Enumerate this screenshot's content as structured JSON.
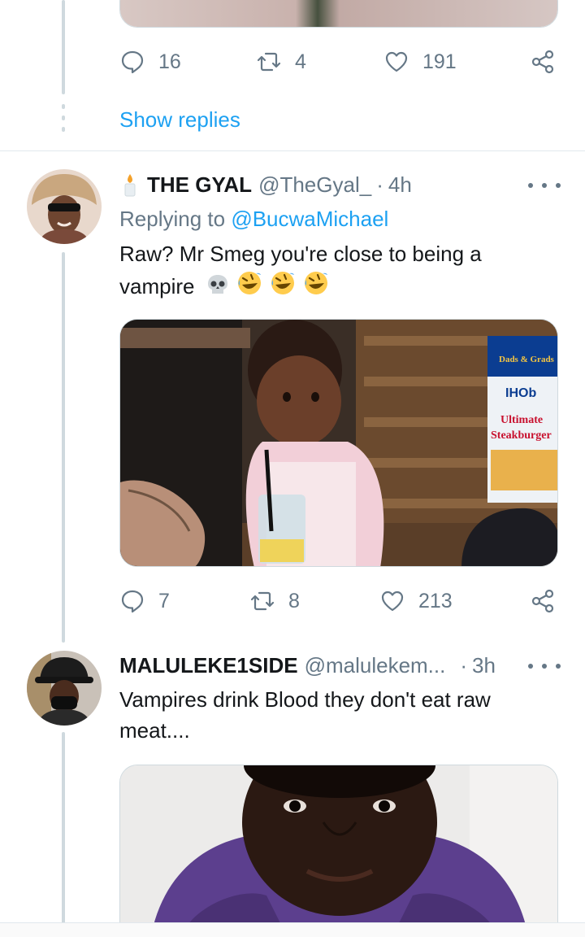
{
  "tweets": [
    {
      "replies": "16",
      "retweets": "4",
      "likes": "191",
      "show_replies": "Show replies"
    },
    {
      "name": "THE GYAL",
      "name_emoji": "candle",
      "handle": "@TheGyal_",
      "separator": "·",
      "time": "4h",
      "replying_prefix": "Replying to",
      "replying_to": "@BucwaMichael",
      "text_line1": "Raw? Mr Smeg you're close to being a",
      "text_line2": "vampire",
      "emojis": [
        "skull",
        "rolling-on-floor-laughing",
        "rolling-on-floor-laughing",
        "rolling-on-floor-laughing"
      ],
      "media_labels": {
        "brand": "IHOb",
        "promo_top": "Dads & Grads",
        "promo_title_1": "Ultimate",
        "promo_title_2": "Steakburger"
      },
      "replies": "7",
      "retweets": "8",
      "likes": "213"
    },
    {
      "name": "MALULEKE1SIDE",
      "handle": "@malulekem...",
      "separator": "·",
      "time": "3h",
      "text_line1": "Vampires drink Blood they don't eat raw",
      "text_line2": "meat...."
    }
  ],
  "colors": {
    "link": "#1da1f2",
    "muted": "#657786",
    "text": "#14171a",
    "thread_line": "#cfd9de"
  }
}
